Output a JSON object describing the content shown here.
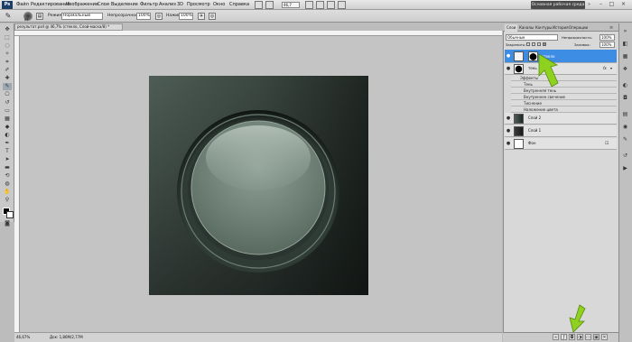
{
  "menubar": {
    "logo": "Ps",
    "items": [
      "Файл",
      "Редактирование",
      "Изображение",
      "Слои",
      "Выделение",
      "Фильтр",
      "Анализ",
      "3D",
      "Просмотр",
      "Окно",
      "Справка"
    ],
    "zoom_value": "46,7",
    "workspace_button": "Основная рабочая среда"
  },
  "options": {
    "brush_size": "89",
    "mode_label": "Режим:",
    "mode_value": "Нормальный",
    "opacity_label": "Непрозрачность:",
    "opacity_value": "100%",
    "flow_label": "Нажим:",
    "flow_value": "100%"
  },
  "document": {
    "tab_title": "результат.psd @ 46,7% (стекло, Слой-маска/8) *",
    "zoom_status": "46,67%",
    "doc_status": "Док: 1,86М/2,77M"
  },
  "panel": {
    "tabs": [
      "Слои",
      "Каналы",
      "Контуры",
      "История",
      "Операции"
    ],
    "active_tab": "Слои",
    "blend_mode": "Обычные",
    "opacity_label": "Непрозрачность:",
    "opacity_value": "100%",
    "lock_label": "Закрепить:",
    "fill_label": "Заливка:",
    "fill_value": "100%",
    "layers": [
      {
        "name": "стекло",
        "selected": true
      },
      {
        "name": "тень",
        "selected": false,
        "fx": "fx"
      },
      {
        "name": "Слой 2",
        "selected": false
      },
      {
        "name": "Слой 1",
        "selected": false
      },
      {
        "name": "Фон",
        "selected": false
      }
    ],
    "effects_header": "Эффекты",
    "effects": [
      "Тень",
      "Внутренняя тень",
      "Внутреннее свечение",
      "Тиснение",
      "Наложение цвета"
    ]
  },
  "colors": {
    "selection": "#3d8de4",
    "arrow": "#8ed11f",
    "artwork_dark": "#263028",
    "artwork_light": "#7f8f86"
  }
}
